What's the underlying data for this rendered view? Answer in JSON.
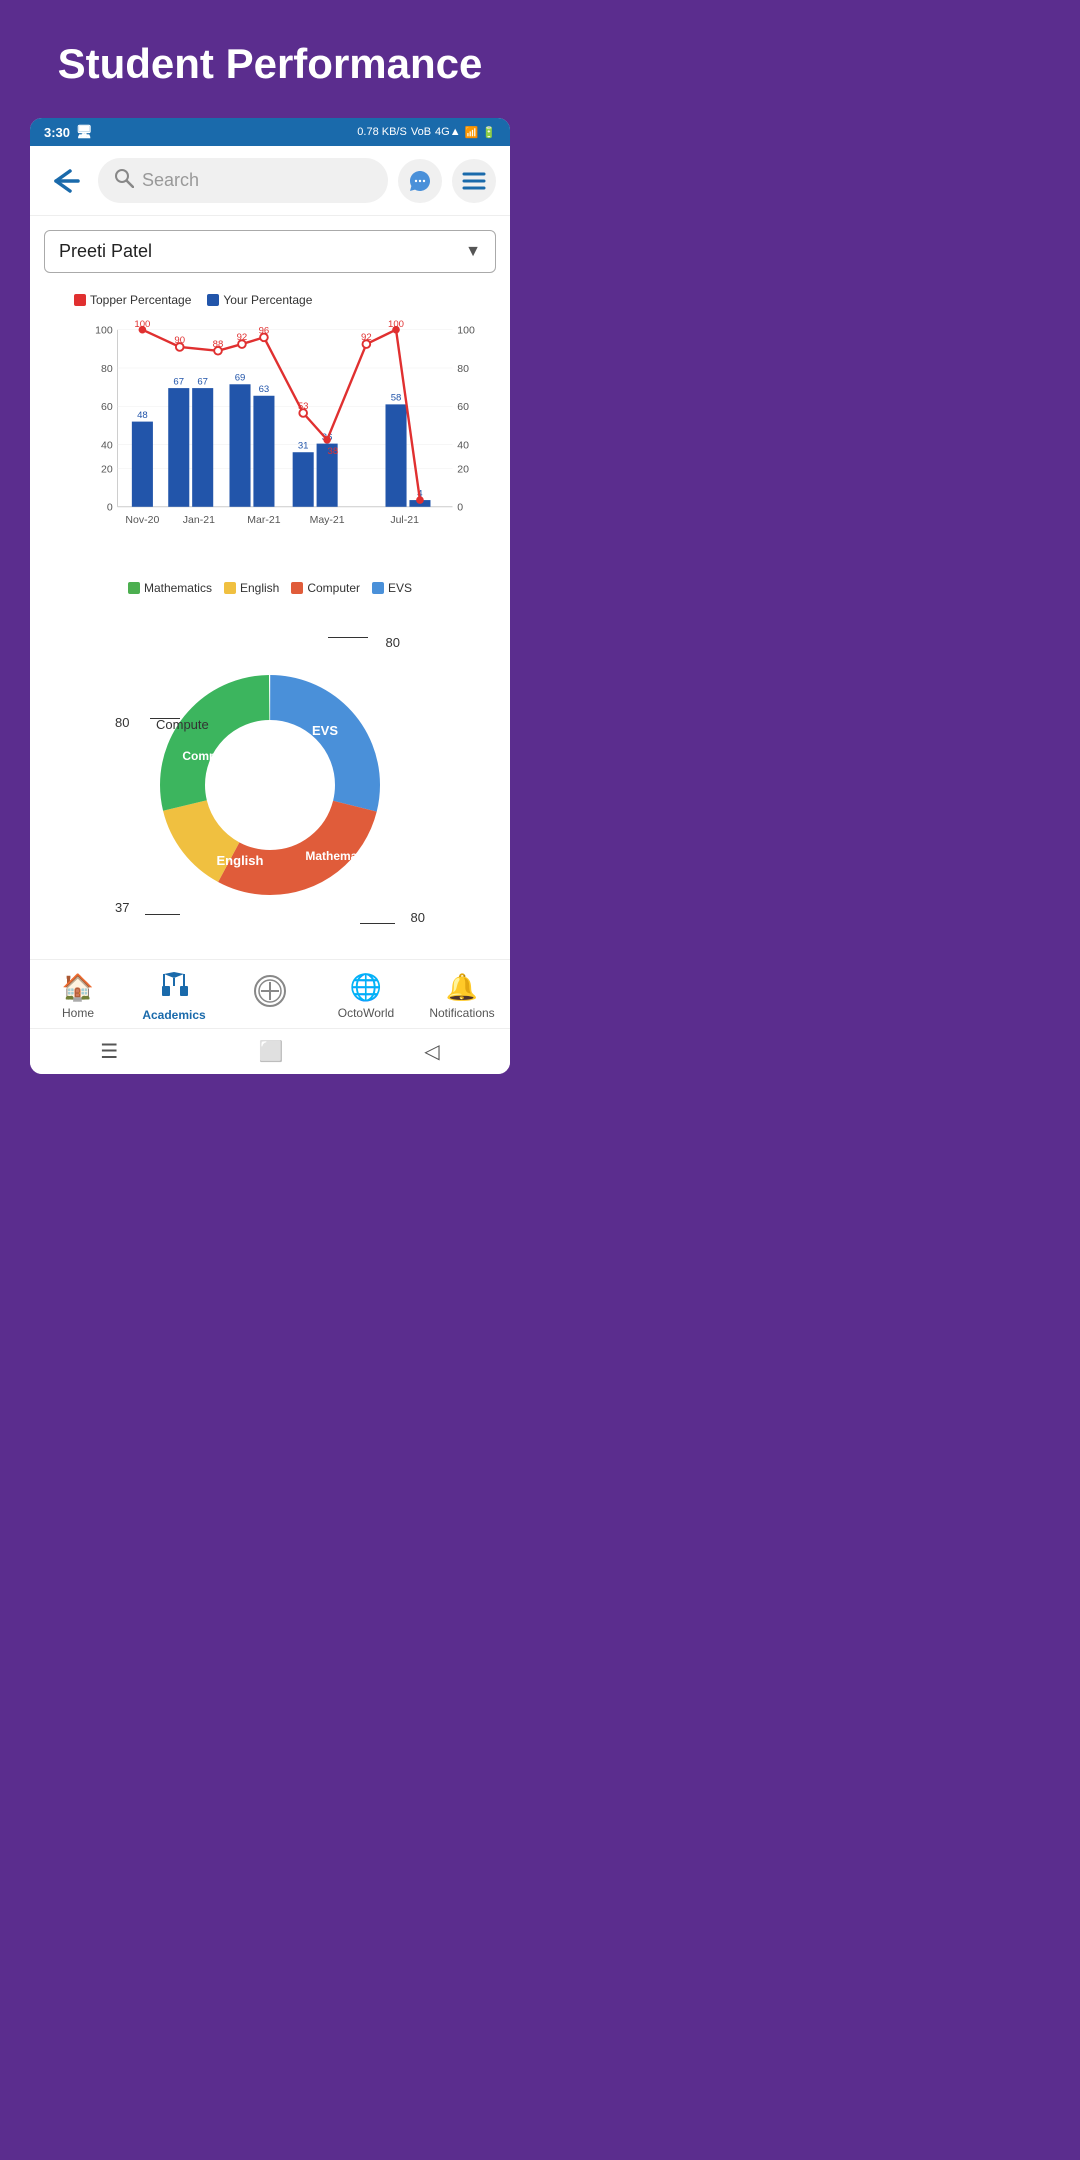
{
  "page": {
    "title": "Student Performance",
    "bg_color": "#5b2d8e"
  },
  "status_bar": {
    "time": "3:30",
    "speed": "0.78 KB/S",
    "network": "4G",
    "battery": "6"
  },
  "top_bar": {
    "search_placeholder": "Search",
    "back_label": "back",
    "message_label": "messages",
    "menu_label": "menu"
  },
  "student_selector": {
    "selected": "Preeti Patel",
    "dropdown_arrow": "▼"
  },
  "chart": {
    "legend_topper": "Topper Percentage",
    "legend_your": "Your Percentage",
    "months": [
      "Nov-20",
      "Jan-21",
      "Mar-21",
      "May-21",
      "Jul-21"
    ],
    "bars": [
      {
        "month": "Nov-20",
        "value": 48
      },
      {
        "month": "Jan-21",
        "value": 67
      },
      {
        "month": "Jan-21b",
        "value": 67
      },
      {
        "month": "Mar-21a",
        "value": 69
      },
      {
        "month": "Mar-21",
        "value": 63
      },
      {
        "month": "May-21a",
        "value": 31
      },
      {
        "month": "May-21",
        "value": 36
      },
      {
        "month": "Jul-21",
        "value": 58
      },
      {
        "month": "Jul-21b",
        "value": 4
      }
    ],
    "topper_line": [
      100,
      90,
      88,
      92,
      96,
      53,
      38,
      92,
      100,
      4
    ],
    "subject_legend": [
      "Mathematics",
      "English",
      "Computer",
      "EVS"
    ]
  },
  "donut_chart": {
    "segments": [
      {
        "label": "EVS",
        "value": 80,
        "color": "#4a90d9",
        "percent": 30
      },
      {
        "label": "Computer",
        "value": 80,
        "color": "#e05c3a",
        "percent": 25
      },
      {
        "label": "English",
        "value": 37,
        "color": "#f0c040",
        "percent": 15
      },
      {
        "label": "Mathematics",
        "value": 80,
        "color": "#3cb55e",
        "percent": 30
      }
    ]
  },
  "bottom_nav": {
    "items": [
      {
        "label": "Home",
        "icon": "🏠",
        "active": false
      },
      {
        "label": "Academics",
        "icon": "✏️",
        "active": true
      },
      {
        "label": "",
        "icon": "⊕",
        "active": false,
        "special": true
      },
      {
        "label": "OctoWorld",
        "icon": "🌐",
        "active": false
      },
      {
        "label": "Notifications",
        "icon": "🔔",
        "active": false
      }
    ]
  },
  "android_nav": {
    "menu_icon": "☰",
    "home_icon": "⬜",
    "back_icon": "◁"
  }
}
